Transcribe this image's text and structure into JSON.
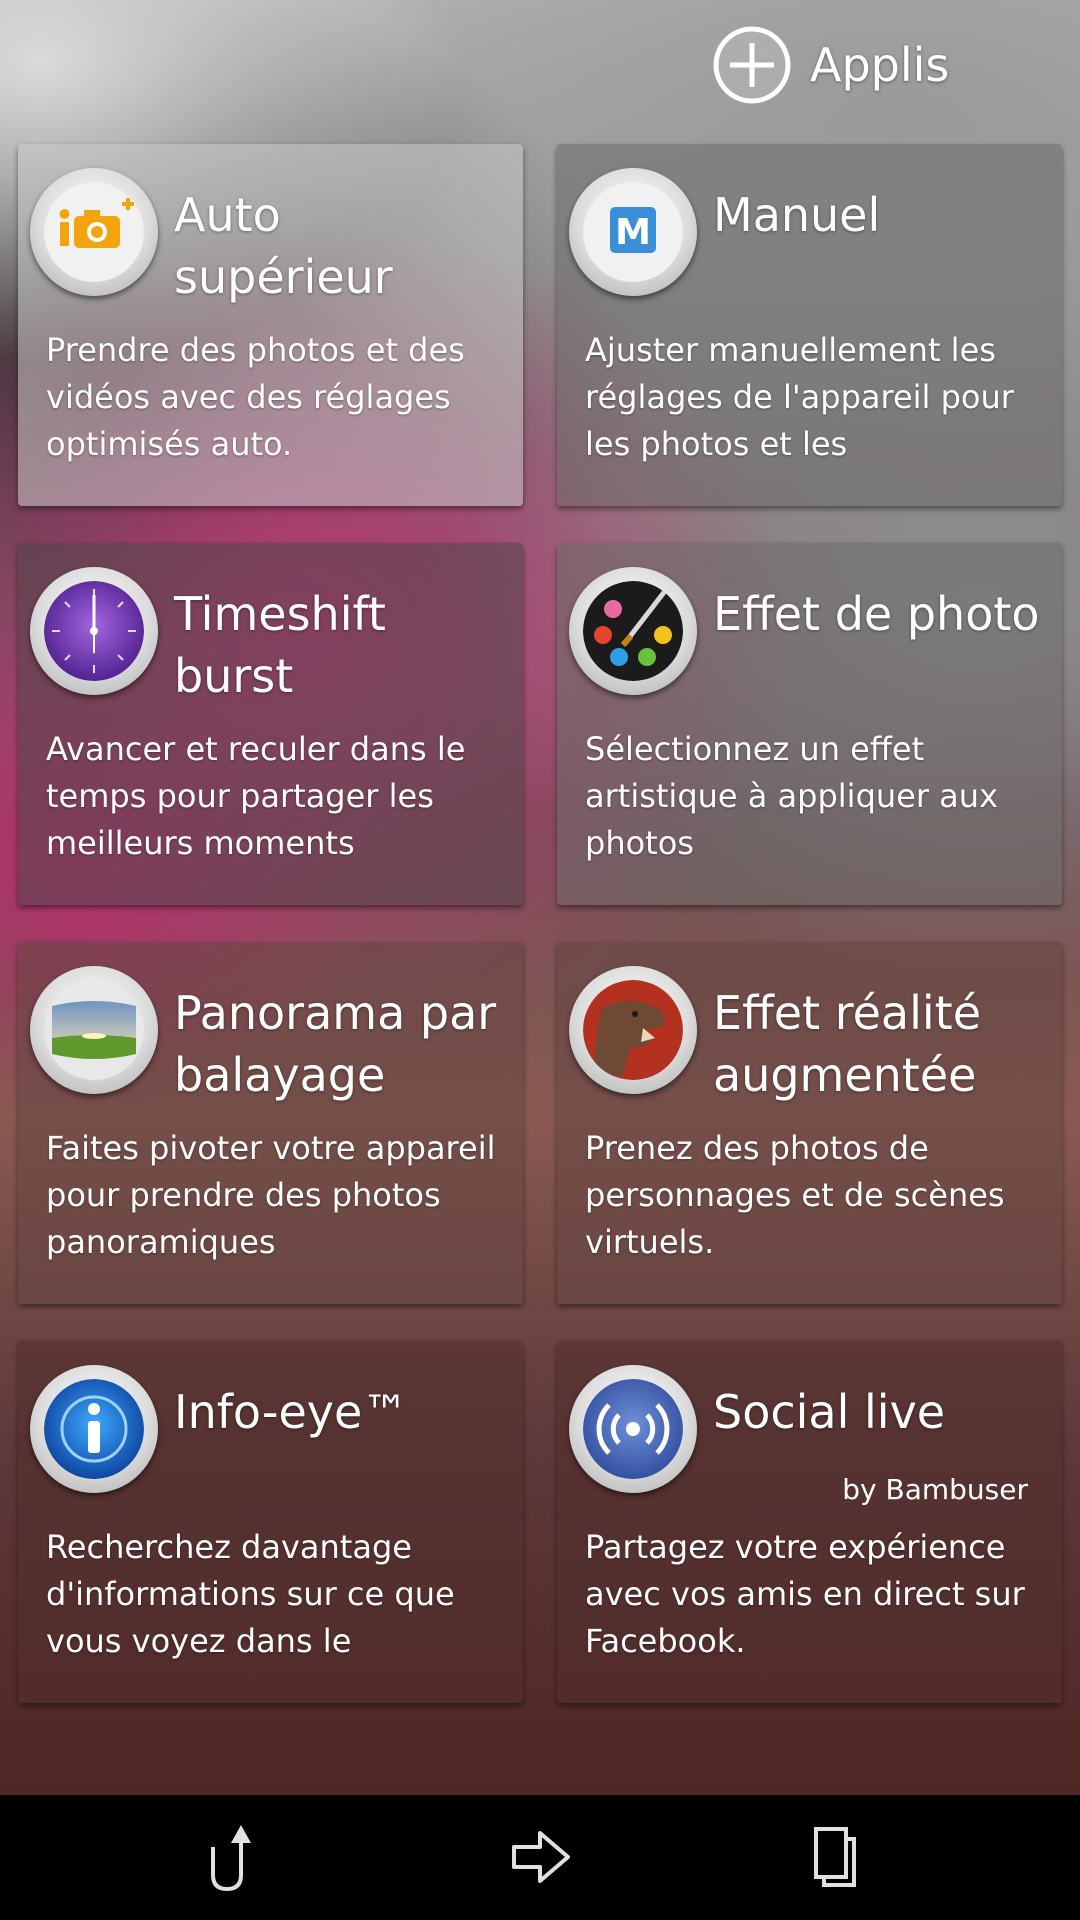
{
  "header": {
    "apps_label": "Applis"
  },
  "tiles": [
    {
      "title": "Auto supérieur",
      "subtitle": "",
      "description": "Prendre des photos et des vidéos avec des réglages optimisés auto.",
      "icon": "superior-auto-icon"
    },
    {
      "title": "Manuel",
      "subtitle": "",
      "description": "Ajuster manuellement les réglages de l'appareil pour les photos et les",
      "icon": "manual-icon"
    },
    {
      "title": "Timeshift burst",
      "subtitle": "",
      "description": "Avancer et reculer dans le temps pour partager les meilleurs moments",
      "icon": "clock-icon"
    },
    {
      "title": "Effet de photo",
      "subtitle": "",
      "description": "Sélectionnez un effet artistique à appliquer aux photos",
      "icon": "palette-icon"
    },
    {
      "title": "Panorama par balayage",
      "subtitle": "",
      "description": "Faites pivoter votre appareil pour prendre des photos panoramiques",
      "icon": "panorama-icon"
    },
    {
      "title": "Effet réalité augmentée",
      "subtitle": "",
      "description": "Prenez des photos de personnages et de scènes virtuels.",
      "icon": "dinosaur-icon"
    },
    {
      "title": "Info-eye™",
      "subtitle": "",
      "description": "Recherchez davantage d'informations sur ce que vous voyez dans le",
      "icon": "info-icon"
    },
    {
      "title": "Social live",
      "subtitle": "by Bambuser",
      "description": "Partagez votre expérience avec vos amis en direct sur Facebook.",
      "icon": "broadcast-icon"
    }
  ],
  "navbar": {
    "buttons": [
      "back-icon",
      "home-icon",
      "recent-apps-icon"
    ]
  }
}
